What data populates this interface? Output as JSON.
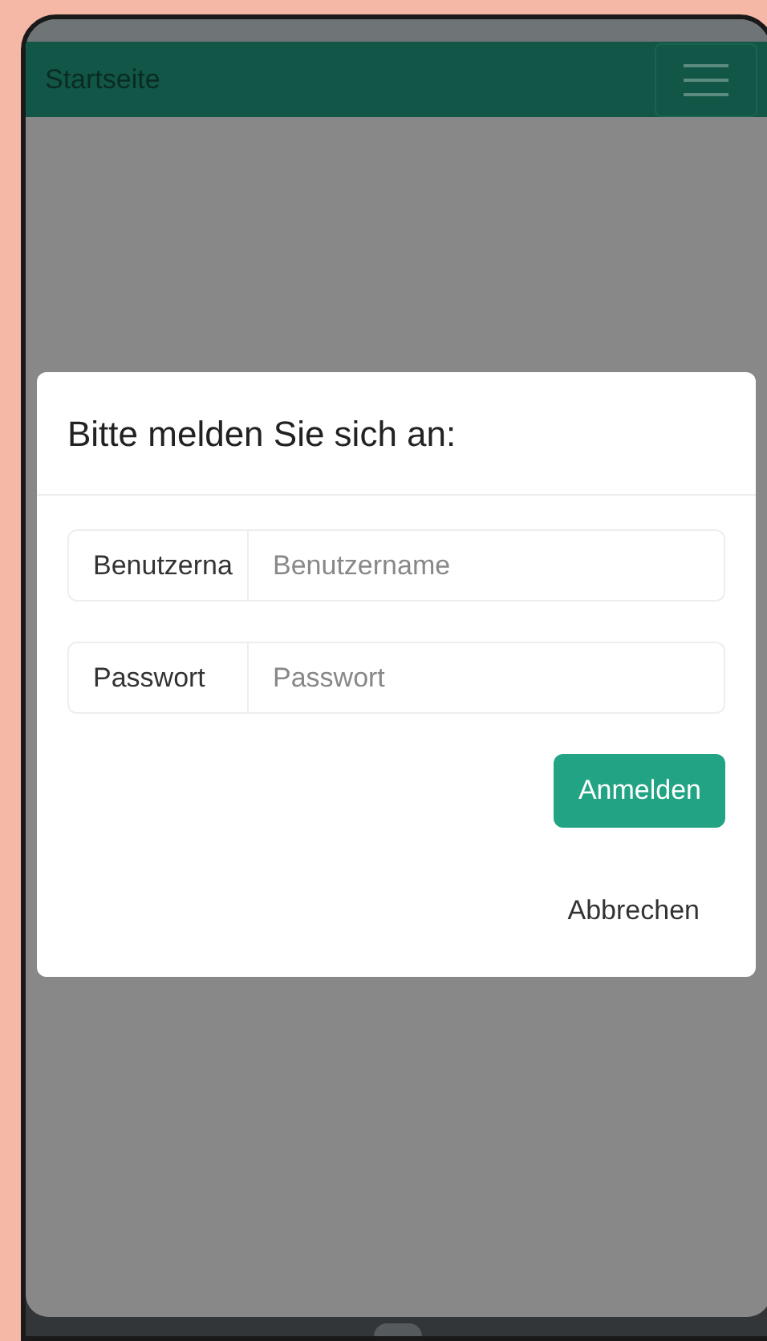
{
  "app_bar": {
    "title": "Startseite"
  },
  "dialog": {
    "title": "Bitte melden Sie sich an:",
    "fields": [
      {
        "label": "Benutzerna",
        "placeholder": "Benutzername"
      },
      {
        "label": "Passwort",
        "placeholder": "Passwort"
      }
    ],
    "submit": "Anmelden",
    "cancel": "Abbrechen"
  }
}
